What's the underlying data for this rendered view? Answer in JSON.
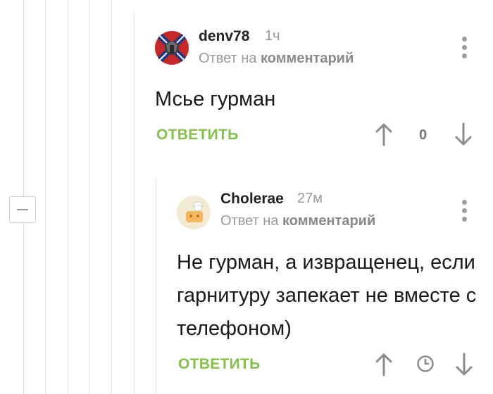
{
  "thread": {
    "collapse_label": "−"
  },
  "comments": [
    {
      "author": "denv78",
      "time": "1ч",
      "reply_prefix": "Ответ на",
      "reply_link": "комментарий",
      "body": "Мсье гурман",
      "reply_label": "ОТВЕТИТЬ",
      "score": "0",
      "avatar_icon": "flag-emblem-avatar"
    },
    {
      "author": "Cholerae",
      "time": "27м",
      "reply_prefix": "Ответ на",
      "reply_link": "комментарий",
      "body": "Не гурман, а извращенец, если гарнитуру запекает не вместе с телефоном)",
      "reply_label": "ОТВЕТИТЬ",
      "score_icon": "clock-icon",
      "avatar_icon": "chef-avatar"
    }
  ],
  "colors": {
    "accent_green": "#84c04a",
    "muted_gray": "#9a9a9a",
    "flag_red": "#c62828",
    "flag_blue": "#1e3a8a"
  }
}
